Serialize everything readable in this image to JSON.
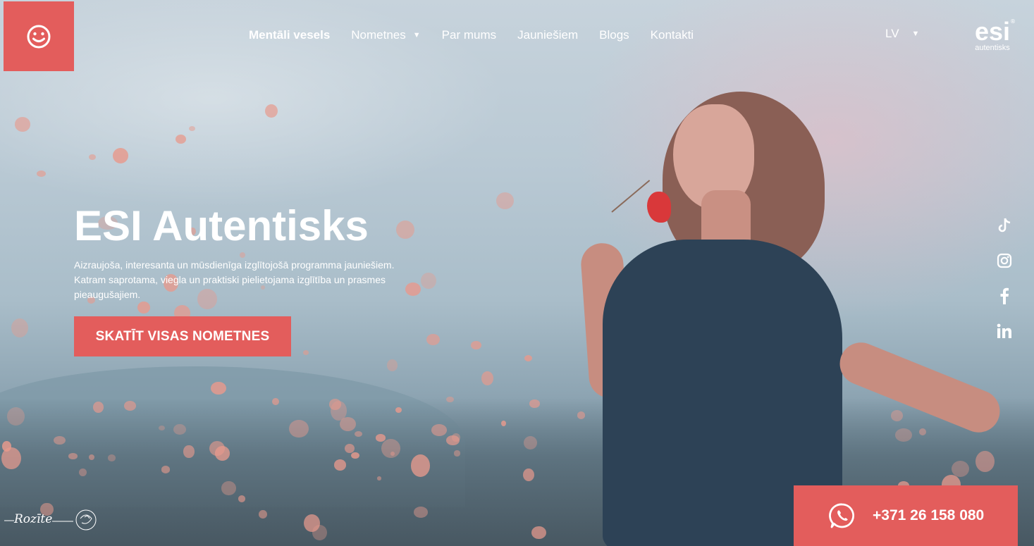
{
  "header": {
    "logo_icon": "smiley-icon",
    "nav": [
      {
        "label": "Mentāli vesels",
        "active": true
      },
      {
        "label": "Nometnes",
        "has_dropdown": true
      },
      {
        "label": "Par mums"
      },
      {
        "label": "Jauniešiem"
      },
      {
        "label": "Blogs"
      },
      {
        "label": "Kontakti"
      }
    ],
    "language": "LV",
    "brand": {
      "name": "esi",
      "sub": "autentisks",
      "reg": "®"
    }
  },
  "hero": {
    "title": "ESI Autentisks",
    "description": "Aizraujoša, interesanta un mūsdienīga izglītojošā programma jauniešiem. Katram saprotama, viegla un praktiski pielietojama izglītība un prasmes pieaugušajiem.",
    "cta_label": "SKATĪT VISAS NOMETNES"
  },
  "socials": [
    "tiktok-icon",
    "instagram-icon",
    "facebook-icon",
    "linkedin-icon"
  ],
  "phone": {
    "icon": "whatsapp-icon",
    "number": "+371 26 158 080"
  },
  "signature": {
    "text": "Rozīte"
  },
  "colors": {
    "accent": "#e35d5c",
    "text": "#ffffff"
  }
}
